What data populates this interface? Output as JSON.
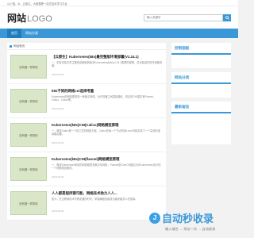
{
  "topnote": "以小搜，AI、云原生、大数据等一站式技术学习平台",
  "header": {
    "logo_cn": "网站",
    "logo_en": "LOGO",
    "search_placeholder": "输入关键字"
  },
  "nav": {
    "items": [
      "首页",
      "网站分类"
    ]
  },
  "breadcrumb": "网站首页",
  "posts": [
    {
      "thumb": "没有图一样精彩",
      "title": "【云原生】Kubernetes(k8s)最完整版环境部署(V1.24.1)",
      "excerpt": "一、前言本篇文章主要是讲解最新版本Kubernetes(k8s)v1.24.1集群的部署，并对各组件的作用做说明。",
      "meta": "2023-08-26"
    },
    {
      "thumb": "没有图一样精彩",
      "title": "k8s不同的网络cni选择考量",
      "excerpt": "Kubernetes的网络模型是一种扁平网络，允许容器之间直接通信，常见的CNI插件有Flannel、Calico、Cilium等。",
      "meta": "2023-08-26"
    },
    {
      "thumb": "没有图一样精彩",
      "title": "Kubernetes(k8s)CNI(Calico)网络模型原理",
      "excerpt": "一、概述Calico是一个纯三层的网络方案，Calico在每一个节点利用Linux内核实现了一个高效的虚拟路由器。",
      "meta": "2023-08-26"
    },
    {
      "thumb": "没有图一样精彩",
      "title": "Kubernetes(k8s)CNI(flannel)网络模型原理",
      "excerpt": "一、概述Kubernetes采用的网络模型是扁平化网络，Flannel是CoreOS团队针对Kubernetes设计的一个网络规划服务。",
      "meta": "2023-08-26"
    },
    {
      "thumb": "没有图一样精彩",
      "title": "人人都是程序猿可能，网络技术助力人人...",
      "excerpt": "如今，在互联网技术不断发展的时代，掌握编程技能成为越来越多人的选择。",
      "meta": "2023-08-26"
    }
  ],
  "sidebar": {
    "widgets": [
      "控制面板",
      "网站分类",
      "最新留言"
    ]
  },
  "watermark": {
    "text": "自动秒收录",
    "sub": "输入域名 → 采访一次 → 自动收录"
  }
}
